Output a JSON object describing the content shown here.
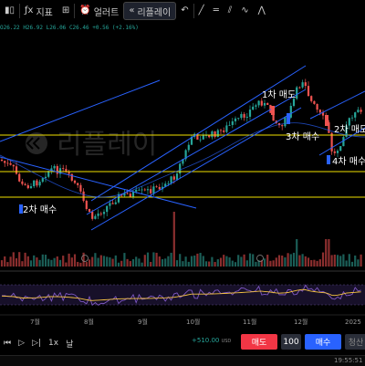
{
  "toolbar": {
    "indicator_label": "지표",
    "alert_label": "얼러트",
    "replay_label": "리플레이"
  },
  "ohlc": {
    "o": "O26.22",
    "h": "H26.92",
    "l": "L26.06",
    "c": "C26.46",
    "change": "+0.56 (+2.16%)"
  },
  "watermark": "리플레이",
  "annotations": {
    "sell1": "1차 매도",
    "sell2": "2차 매도",
    "buy2": "2차 매수",
    "buy3": "3차 매수",
    "buy4": "4차 매수"
  },
  "xaxis": [
    "7월",
    "8월",
    "9월",
    "10월",
    "11월",
    "12월",
    "2025"
  ],
  "bottom": {
    "speed": "1x",
    "interval": "날",
    "pnl_value": "+510.00",
    "pnl_currency": "USD",
    "sell_label": "매도",
    "quantity": "100",
    "buy_label": "매수",
    "cut_label": "청산",
    "clock": "19:55:51"
  },
  "colors": {
    "up": "#26a69a",
    "down": "#ef5350",
    "trendline": "#2962ff",
    "support": "#f0e000",
    "rsi": "#7e57c2",
    "rsi_ma": "#f5c242"
  }
}
